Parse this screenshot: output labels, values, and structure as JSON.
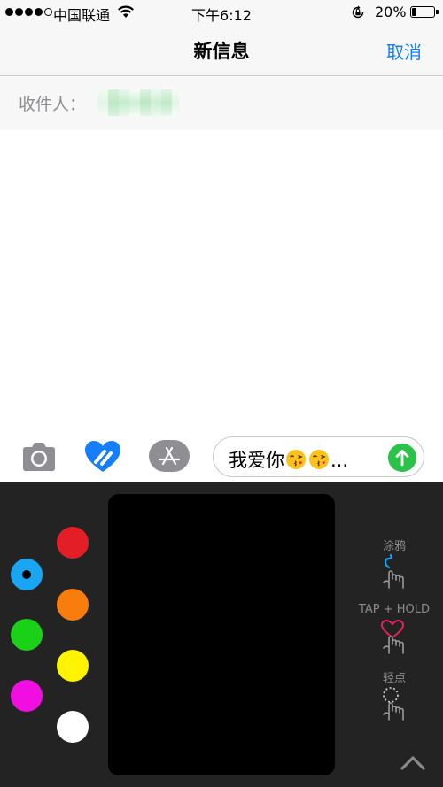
{
  "status_bar": {
    "carrier": "中国联通",
    "time": "下午6:12",
    "battery_percent": "20%",
    "battery_level": 0.2,
    "signal_bars_filled": 4,
    "icons": [
      "signal-dots-icon",
      "wifi-icon",
      "orientation-lock-icon",
      "battery-icon"
    ]
  },
  "nav": {
    "title": "新信息",
    "cancel_label": "取消",
    "accent_color": "#157efb"
  },
  "recipient": {
    "label": "收件人："
  },
  "toolbar": {
    "icons": [
      "camera-icon",
      "digital-touch-heart-icon",
      "app-store-icon",
      "send-arrow-icon"
    ],
    "message_text": "我爱你",
    "emoji": [
      "face-blowing-kiss",
      "face-blowing-kiss"
    ],
    "message_ellipsis": "...",
    "send_color": "#2bc24a"
  },
  "digital_touch": {
    "colors": [
      {
        "name": "blue",
        "hex": "#1aa5f2",
        "selected": true
      },
      {
        "name": "red",
        "hex": "#e41e26",
        "selected": false
      },
      {
        "name": "orange",
        "hex": "#f97d0c",
        "selected": false
      },
      {
        "name": "green",
        "hex": "#1ad117",
        "selected": false
      },
      {
        "name": "yellow",
        "hex": "#fff300",
        "selected": false
      },
      {
        "name": "magenta",
        "hex": "#f10ee0",
        "selected": false
      },
      {
        "name": "white",
        "hex": "#ffffff",
        "selected": false
      }
    ],
    "hints": [
      {
        "label": "涂鸦",
        "icon": "finger-sketch-icon"
      },
      {
        "label": "TAP + HOLD",
        "icon": "finger-heartbeat-icon"
      },
      {
        "label": "轻点",
        "icon": "finger-tap-icon"
      }
    ],
    "expand_icon": "chevron-up-icon"
  }
}
